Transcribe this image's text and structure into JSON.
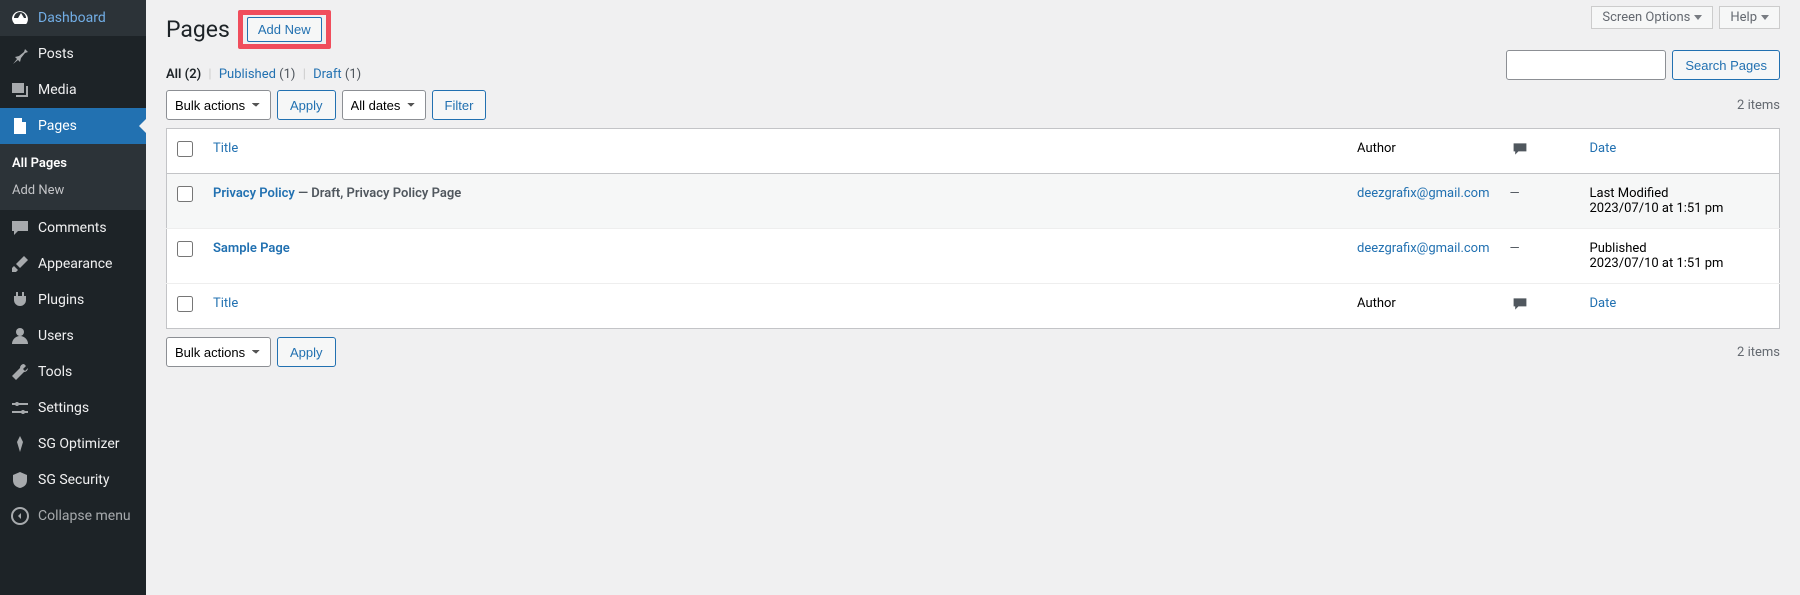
{
  "sidebar": {
    "dashboard": "Dashboard",
    "posts": "Posts",
    "media": "Media",
    "pages": "Pages",
    "all_pages": "All Pages",
    "add_new_sub": "Add New",
    "comments": "Comments",
    "appearance": "Appearance",
    "plugins": "Plugins",
    "users": "Users",
    "tools": "Tools",
    "settings": "Settings",
    "sg_optimizer": "SG Optimizer",
    "sg_security": "SG Security",
    "collapse": "Collapse menu"
  },
  "topbar": {
    "screen_options": "Screen Options",
    "help": "Help"
  },
  "header": {
    "title": "Pages",
    "add_new": "Add New"
  },
  "filters": {
    "all": "All",
    "all_count": "(2)",
    "published": "Published",
    "published_count": "(1)",
    "draft": "Draft",
    "draft_count": "(1)"
  },
  "search": {
    "button": "Search Pages"
  },
  "bulk": {
    "placeholder": "Bulk actions",
    "apply": "Apply",
    "all_dates": "All dates",
    "filter": "Filter"
  },
  "items_count": "2 items",
  "columns": {
    "title": "Title",
    "author": "Author",
    "date": "Date"
  },
  "rows": [
    {
      "title": "Privacy Policy",
      "state": " — Draft, Privacy Policy Page",
      "author": "deezgrafix@gmail.com",
      "comments": "—",
      "date_status": "Last Modified",
      "date_value": "2023/07/10 at 1:51 pm"
    },
    {
      "title": "Sample Page",
      "state": "",
      "author": "deezgrafix@gmail.com",
      "comments": "—",
      "date_status": "Published",
      "date_value": "2023/07/10 at 1:51 pm"
    }
  ]
}
